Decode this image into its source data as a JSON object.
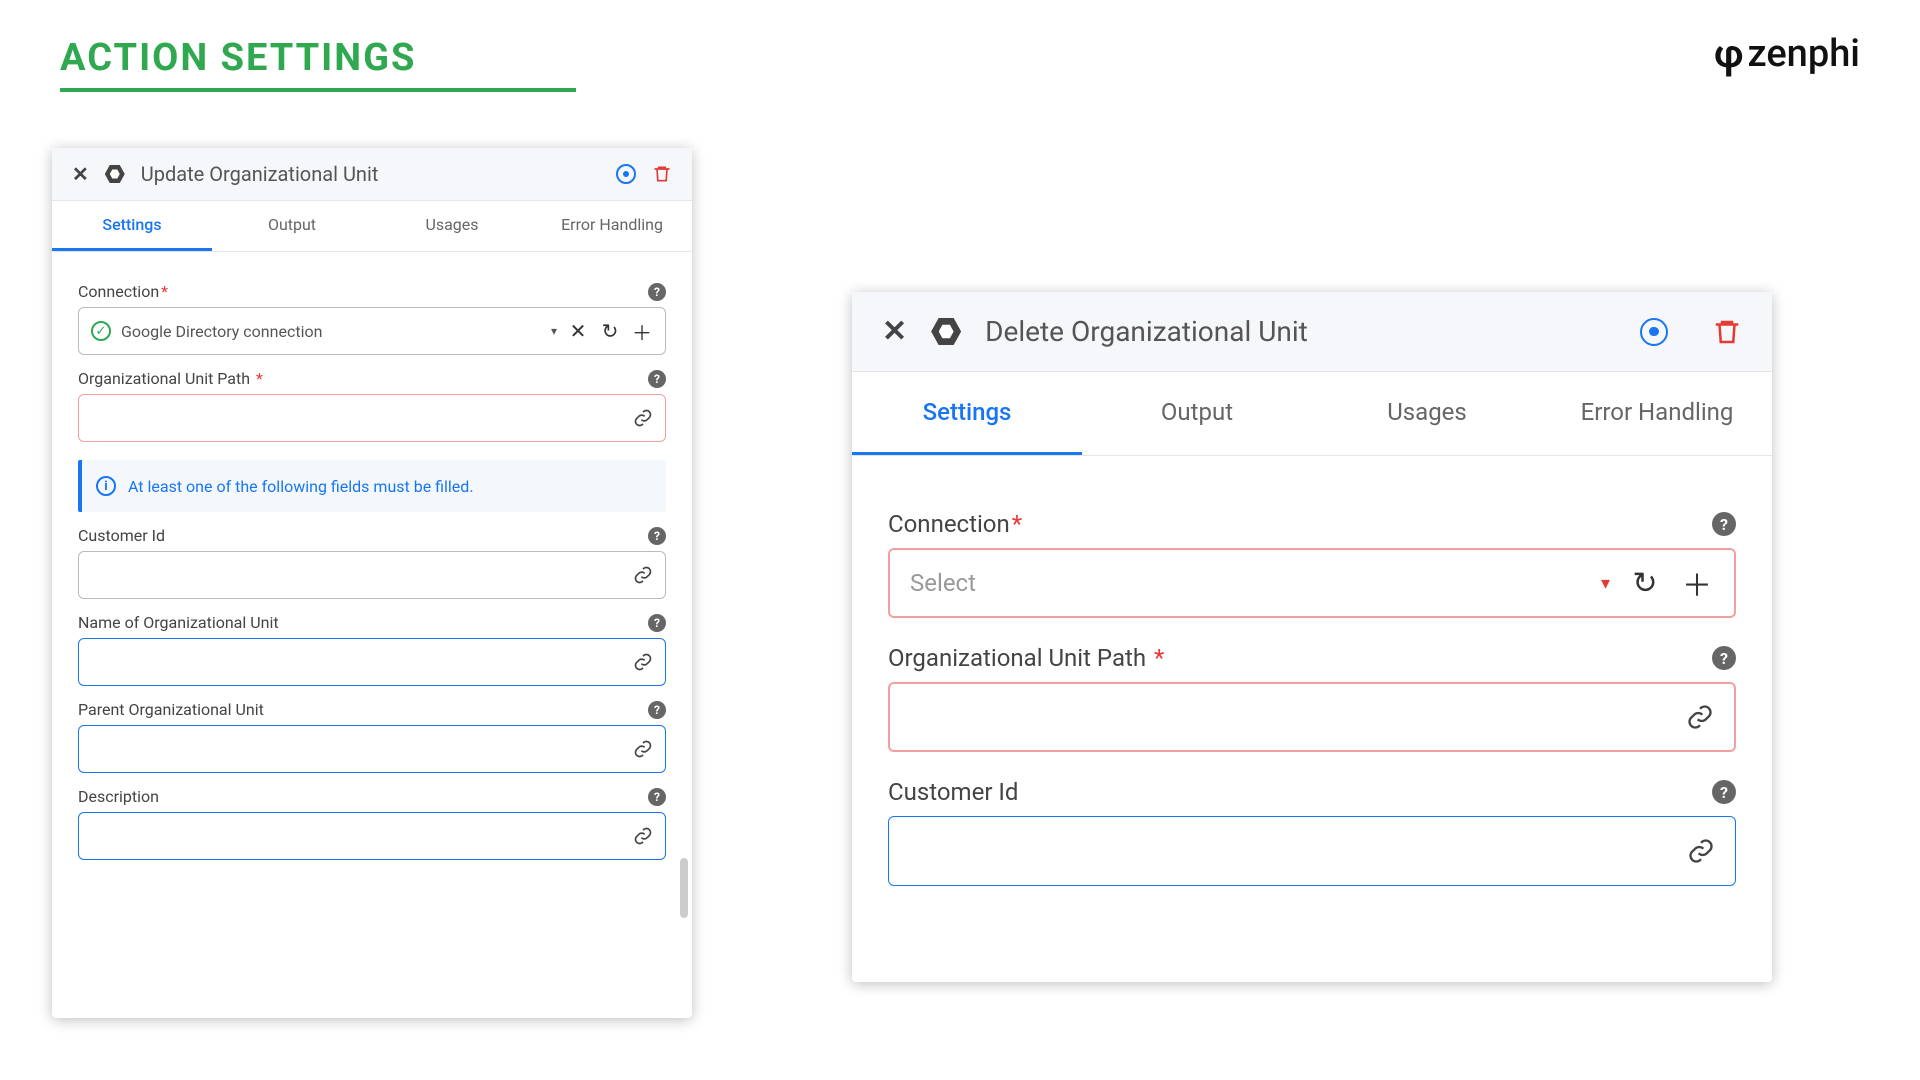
{
  "page": {
    "title": "ACTION SETTINGS"
  },
  "brand": {
    "name": "zenphi"
  },
  "tabs": {
    "settings": "Settings",
    "output": "Output",
    "usages": "Usages",
    "error": "Error Handling"
  },
  "labels": {
    "connection": "Connection",
    "org_path": "Organizational Unit Path",
    "customer_id": "Customer Id",
    "name_ou": "Name of Organizational Unit",
    "parent_ou": "Parent Organizational Unit",
    "description": "Description",
    "select_placeholder": "Select"
  },
  "panelLeft": {
    "title": "Update Organizational Unit",
    "connection_value": "Google Directory connection",
    "info_text": "At least one of the following fields must be filled."
  },
  "panelRight": {
    "title": "Delete Organizational Unit"
  }
}
